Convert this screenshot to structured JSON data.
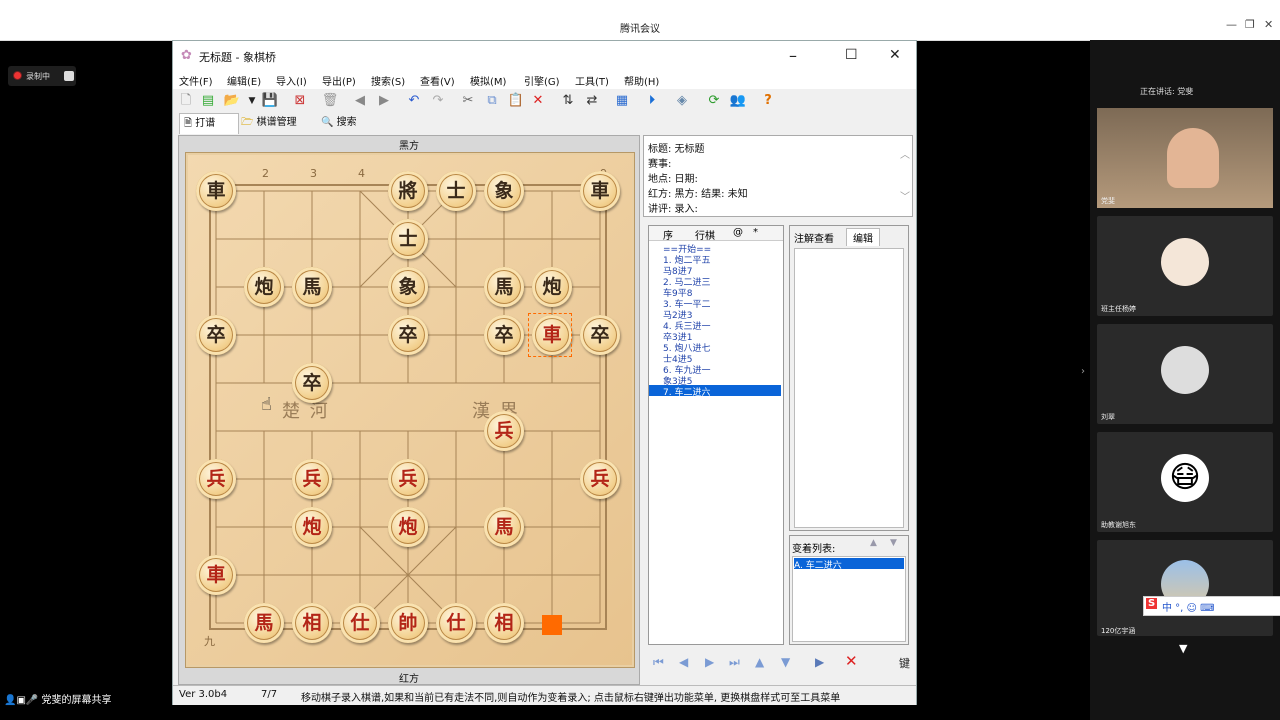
{
  "meeting": {
    "title": "腾讯会议",
    "recording_label": "录制中",
    "screen_share_label": "党斐的屏幕共享",
    "speaking_label": "正在讲话: 党斐"
  },
  "participants": [
    {
      "name": "党斐"
    },
    {
      "name": "班主任杨婷"
    },
    {
      "name": "刘翠"
    },
    {
      "name": "助教谢旭东"
    },
    {
      "name": "120亿宇涵"
    }
  ],
  "ime": {
    "text": "中 °, ☺ ⌨"
  },
  "app": {
    "title": "无标题 - 象棋桥",
    "menus": [
      "文件(F)",
      "编辑(E)",
      "导入(I)",
      "导出(P)",
      "搜索(S)",
      "查看(V)",
      "模拟(M)",
      "引擎(G)",
      "工具(T)",
      "帮助(H)"
    ],
    "tabs": [
      "打谱",
      "棋谱管理",
      "搜索"
    ],
    "board_top_label": "黑方",
    "board_bottom_label": "红方",
    "river_left": "楚 河",
    "river_right": "漢 界",
    "top_coords": [
      "2",
      "3",
      "4",
      "9"
    ],
    "bottom_coords": [
      "九"
    ],
    "info": {
      "line1": "标题: 无标题",
      "line2": "赛事:",
      "line3": "地点:      日期:",
      "line4": "红方:      黑方:      结果: 未知",
      "line5": "讲评:      录入:"
    },
    "moves_header": [
      "序",
      "行棋",
      "@",
      "*"
    ],
    "moves": [
      "==开始==",
      "1.  炮二平五",
      "    马8进7",
      "2.  马二进三",
      "    车9平8",
      "3.  车一平二",
      "    马2进3",
      "4.  兵三进一",
      "    卒3进1",
      "5.  炮八进七",
      "    士4进5",
      "6.  车九进一",
      "    象3进5",
      "7.  车二进六"
    ],
    "annot_tabs": [
      "注解查看",
      "编辑"
    ],
    "variations_label": "变着列表:",
    "variation_item": "A. 车二进六",
    "status_version": "Ver 3.0b4",
    "status_move": "7/7",
    "status_hint": "移动棋子录入棋谱,如果和当前已有走法不同,则自动作为变着录入; 点击鼠标右键弹出功能菜单, 更换棋盘样式可至工具菜单",
    "nav_end_label": "键"
  },
  "pieces": [
    {
      "char": "車",
      "side": "black",
      "col": 0,
      "row": 0
    },
    {
      "char": "將",
      "side": "black",
      "col": 4,
      "row": 0
    },
    {
      "char": "士",
      "side": "black",
      "col": 5,
      "row": 0
    },
    {
      "char": "象",
      "side": "black",
      "col": 6,
      "row": 0
    },
    {
      "char": "車",
      "side": "black",
      "col": 8,
      "row": 0
    },
    {
      "char": "士",
      "side": "black",
      "col": 4,
      "row": 1
    },
    {
      "char": "炮",
      "side": "black",
      "col": 1,
      "row": 2
    },
    {
      "char": "馬",
      "side": "black",
      "col": 2,
      "row": 2
    },
    {
      "char": "象",
      "side": "black",
      "col": 4,
      "row": 2
    },
    {
      "char": "馬",
      "side": "black",
      "col": 6,
      "row": 2
    },
    {
      "char": "炮",
      "side": "black",
      "col": 7,
      "row": 2
    },
    {
      "char": "卒",
      "side": "black",
      "col": 0,
      "row": 3
    },
    {
      "char": "卒",
      "side": "black",
      "col": 4,
      "row": 3
    },
    {
      "char": "卒",
      "side": "black",
      "col": 6,
      "row": 3
    },
    {
      "char": "車",
      "side": "red",
      "col": 7,
      "row": 3
    },
    {
      "char": "卒",
      "side": "black",
      "col": 8,
      "row": 3
    },
    {
      "char": "卒",
      "side": "black",
      "col": 2,
      "row": 4
    },
    {
      "char": "兵",
      "side": "red",
      "col": 6,
      "row": 5
    },
    {
      "char": "兵",
      "side": "red",
      "col": 0,
      "row": 6
    },
    {
      "char": "兵",
      "side": "red",
      "col": 2,
      "row": 6
    },
    {
      "char": "兵",
      "side": "red",
      "col": 4,
      "row": 6
    },
    {
      "char": "兵",
      "side": "red",
      "col": 8,
      "row": 6
    },
    {
      "char": "炮",
      "side": "red",
      "col": 2,
      "row": 7
    },
    {
      "char": "炮",
      "side": "red",
      "col": 4,
      "row": 7
    },
    {
      "char": "馬",
      "side": "red",
      "col": 6,
      "row": 7
    },
    {
      "char": "車",
      "side": "red",
      "col": 0,
      "row": 8
    },
    {
      "char": "馬",
      "side": "red",
      "col": 1,
      "row": 9
    },
    {
      "char": "相",
      "side": "red",
      "col": 2,
      "row": 9
    },
    {
      "char": "仕",
      "side": "red",
      "col": 3,
      "row": 9
    },
    {
      "char": "帥",
      "side": "red",
      "col": 4,
      "row": 9
    },
    {
      "char": "仕",
      "side": "red",
      "col": 5,
      "row": 9
    },
    {
      "char": "相",
      "side": "red",
      "col": 6,
      "row": 9
    }
  ]
}
